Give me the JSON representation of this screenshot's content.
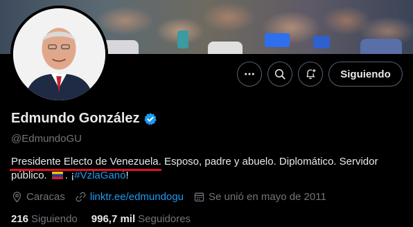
{
  "profile": {
    "name": "Edmundo González",
    "handle": "@EdmundoGU",
    "verified": true,
    "follow_button": "Siguiendo",
    "bio": {
      "highlighted": "Presidente Electo de Venezuela",
      "rest_line": ". Esposo, padre y abuelo. Diplomático. Servidor público.",
      "after_flag": ". ¡",
      "hashtag": "#VzlaGanó",
      "end": "!"
    },
    "location": "Caracas",
    "link": "linktr.ee/edmundogu",
    "joined": "Se unió en mayo de 2011",
    "following_count": "216",
    "following_label": "Siguiendo",
    "followers_count": "996,7 mil",
    "followers_label": "Seguidores"
  },
  "icons": {
    "more": "more-icon",
    "search": "search-icon",
    "notify": "bell-plus-icon",
    "verified": "verified-badge-icon",
    "location": "location-pin-icon",
    "link": "link-icon",
    "calendar": "calendar-icon"
  },
  "colors": {
    "accent": "#1d9bf0",
    "underline": "#e0101e",
    "muted": "#71767b"
  }
}
